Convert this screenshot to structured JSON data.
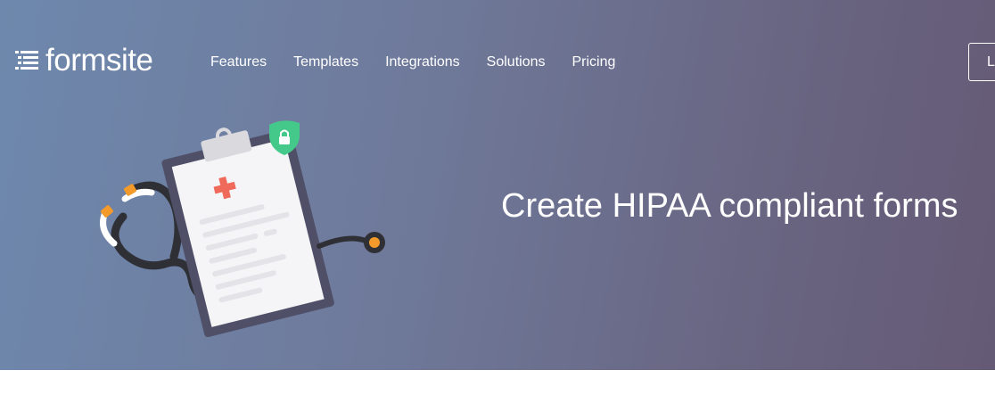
{
  "brand": {
    "name": "formsite",
    "logo_icon": "list-lines-icon"
  },
  "nav": {
    "items": [
      {
        "label": "Features"
      },
      {
        "label": "Templates"
      },
      {
        "label": "Integrations"
      },
      {
        "label": "Solutions"
      },
      {
        "label": "Pricing"
      }
    ],
    "login_label": "Log In"
  },
  "hero": {
    "headline": "Create HIPAA compliant forms",
    "illustration": "clipboard-stethoscope-shield-icon"
  },
  "colors": {
    "gradient_start": "#6e88ad",
    "gradient_end": "#655a76",
    "shield_green": "#45c98a",
    "cross_red": "#ef6a5a",
    "accent_orange": "#f39a2b"
  }
}
